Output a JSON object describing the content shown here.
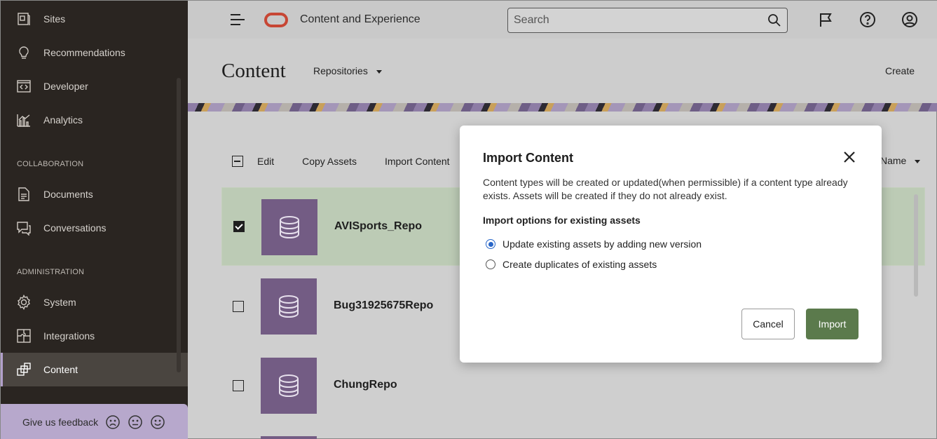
{
  "sidebar": {
    "items_top": [
      {
        "label": "Sites",
        "icon": "sites-icon"
      },
      {
        "label": "Recommendations",
        "icon": "lightbulb-icon"
      },
      {
        "label": "Developer",
        "icon": "code-icon"
      },
      {
        "label": "Analytics",
        "icon": "analytics-icon"
      }
    ],
    "section_collab": "COLLABORATION",
    "items_collab": [
      {
        "label": "Documents",
        "icon": "documents-icon"
      },
      {
        "label": "Conversations",
        "icon": "conversations-icon"
      }
    ],
    "section_admin": "ADMINISTRATION",
    "items_admin": [
      {
        "label": "System",
        "icon": "gear-icon"
      },
      {
        "label": "Integrations",
        "icon": "integrations-icon"
      },
      {
        "label": "Content",
        "icon": "content-icon"
      }
    ],
    "feedback_label": "Give us feedback"
  },
  "header": {
    "app_title": "Content and Experience",
    "search_placeholder": "Search"
  },
  "page": {
    "title": "Content",
    "repositories_label": "Repositories",
    "create_label": "Create"
  },
  "toolbar": {
    "edit": "Edit",
    "copy_assets": "Copy Assets",
    "import_content": "Import Content",
    "sort_label": "Name"
  },
  "rows": [
    {
      "name": "AVISports_Repo",
      "selected": true
    },
    {
      "name": "Bug31925675Repo",
      "selected": false
    },
    {
      "name": "ChungRepo",
      "selected": false
    }
  ],
  "modal": {
    "title": "Import Content",
    "description": "Content types will be created or updated(when permissible) if a content type already exists. Assets will be created if they do not already exist.",
    "options_heading": "Import options for existing assets",
    "option_update": "Update existing assets by adding new version",
    "option_duplicate": "Create duplicates of existing assets",
    "selected_option": "update",
    "cancel_label": "Cancel",
    "import_label": "Import"
  },
  "colors": {
    "sidebar_bg": "#2a2521",
    "accent_green": "#5b7a4c",
    "thumb_purple": "#735c84",
    "oracle_red": "#c74634",
    "selected_row": "#bccbb5"
  }
}
